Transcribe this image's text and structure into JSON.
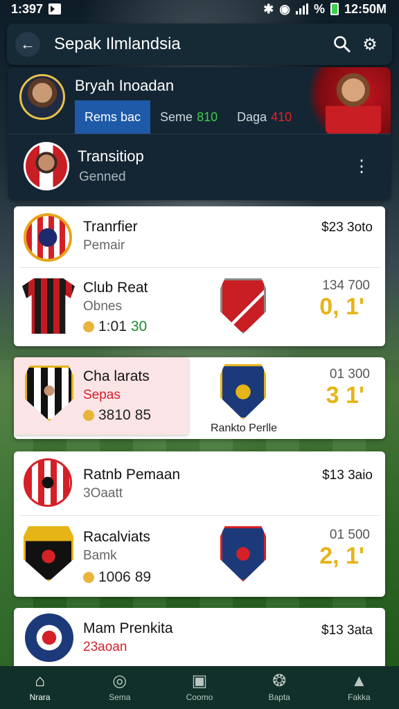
{
  "status_bar": {
    "time": "1:397",
    "right_text": "12:50M",
    "percent": "%"
  },
  "app_bar": {
    "title": "Sepak Ilmlandsia"
  },
  "profile": {
    "name": "Bryah Inoadan",
    "tabs": [
      {
        "label": "Rems bac",
        "num": ""
      },
      {
        "label": "Seme",
        "num": "810"
      },
      {
        "label": "Daga",
        "num": "410"
      }
    ],
    "section_title": "Transitiop",
    "section_sub": "Genned"
  },
  "cards": [
    {
      "rows": [
        {
          "title": "Tranrfier",
          "subtitle": "Pemair",
          "price": "$23 3oto"
        },
        {
          "title": "Club Reat",
          "subtitle": "Obnes",
          "coins": "1:01",
          "coins_extra": "30",
          "stat_small": "134 700",
          "stat_big": "0, 1'"
        }
      ]
    },
    {
      "rows": [
        {
          "title": "Cha larats",
          "subtitle": "Sepas",
          "coins": "3810",
          "coins_extra": "85",
          "crest_caption": "Rankto Perlle",
          "stat_small": "01 300",
          "stat_big": "3 1'"
        }
      ]
    },
    {
      "rows": [
        {
          "title": "Ratnb Pemaan",
          "subtitle": "3Oaatt",
          "price": "$13 3aio"
        },
        {
          "title": "Racalviats",
          "subtitle": "Bamk",
          "coins": "1006",
          "coins_extra": "89",
          "stat_small": "01 500",
          "stat_big": "2, 1'"
        }
      ]
    },
    {
      "rows": [
        {
          "title": "Mam Prenkita",
          "subtitle": "23aoan",
          "price": "$13 3ata"
        }
      ]
    }
  ],
  "bottom_nav": [
    {
      "label": "Nrara",
      "icon": "home-icon"
    },
    {
      "label": "Sema",
      "icon": "ball-icon"
    },
    {
      "label": "Coomo",
      "icon": "clipboard-icon"
    },
    {
      "label": "Bapta",
      "icon": "trophy-icon"
    },
    {
      "label": "Fakka",
      "icon": "person-icon"
    }
  ],
  "colors": {
    "accent_blue": "#1e5aa8",
    "gold": "#e6b416",
    "red": "#d4202a",
    "nav_bg": "#11302a"
  }
}
